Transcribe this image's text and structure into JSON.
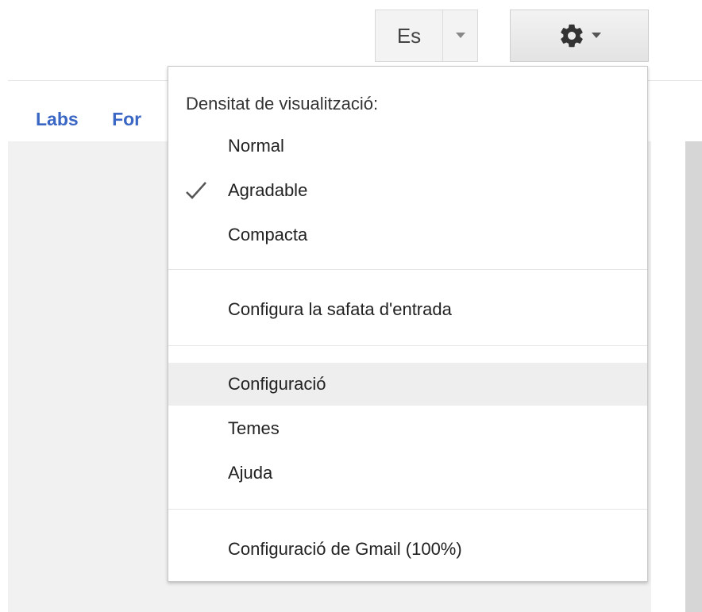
{
  "nav": {
    "labs": "Labs",
    "fo": "For"
  },
  "language": {
    "label": "Es"
  },
  "menu": {
    "header": "Densitat de visualització:",
    "density_options": [
      {
        "label": "Normal",
        "checked": false
      },
      {
        "label": "Agradable",
        "checked": true
      },
      {
        "label": "Compacta",
        "checked": false
      }
    ],
    "configure_inbox": "Configura la safata d'entrada",
    "settings": "Configuració",
    "themes": "Temes",
    "help": "Ajuda",
    "gmail_config": "Configuració de Gmail (100%)"
  },
  "icons": {
    "gear": "gear-icon",
    "caret": "chevron-down-icon",
    "check": "check-icon"
  },
  "colors": {
    "link": "#3a66c4",
    "highlight": "#eeeeee"
  }
}
